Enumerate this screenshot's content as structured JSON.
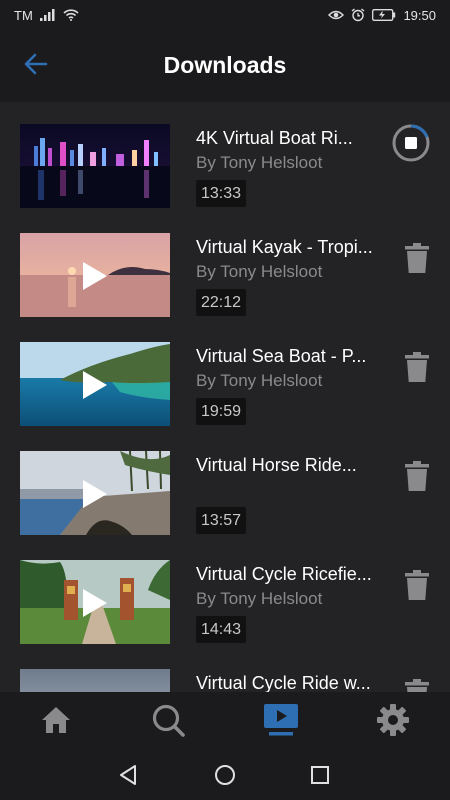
{
  "status_bar": {
    "carrier": "TM",
    "time": "19:50",
    "icons": [
      "signal-icon",
      "wifi-icon",
      "eye-icon",
      "alarm-icon",
      "battery-icon"
    ]
  },
  "header": {
    "title": "Downloads",
    "back_icon": "arrow-left-icon"
  },
  "downloads": [
    {
      "title": "4K Virtual Boat Ri...",
      "author": "By Tony Helsloot",
      "duration": "13:33",
      "action": "stop-download-icon",
      "scene": "night-city-skyline",
      "play_icon": false
    },
    {
      "title": "Virtual Kayak - Tropi...",
      "author": "By Tony Helsloot",
      "duration": "22:12",
      "action": "trash-icon",
      "scene": "sunset-sea",
      "play_icon": true
    },
    {
      "title": "Virtual Sea Boat - P...",
      "author": "By Tony Helsloot",
      "duration": "19:59",
      "action": "trash-icon",
      "scene": "tropical-sea",
      "play_icon": true
    },
    {
      "title": "Virtual Horse Ride...",
      "author": "",
      "duration": "13:57",
      "action": "trash-icon",
      "scene": "seaside-promenade",
      "play_icon": true
    },
    {
      "title": "Virtual Cycle Ricefie...",
      "author": "By Tony Helsloot",
      "duration": "14:43",
      "action": "trash-icon",
      "scene": "rice-field-path",
      "play_icon": true
    },
    {
      "title": "Virtual Cycle Ride w...",
      "author": "",
      "duration": "",
      "action": "trash-icon",
      "scene": "cloudy-sky",
      "play_icon": false
    }
  ],
  "bottom_nav": [
    {
      "icon": "home-icon",
      "active": false
    },
    {
      "icon": "search-icon",
      "active": false
    },
    {
      "icon": "downloads-icon",
      "active": true
    },
    {
      "icon": "settings-icon",
      "active": false
    }
  ],
  "colors": {
    "accent": "#2e6fb4",
    "background": "#232325",
    "bar": "#1b1b1d",
    "icon_gray": "#8a8a8c",
    "duration_bg": "#111112"
  }
}
